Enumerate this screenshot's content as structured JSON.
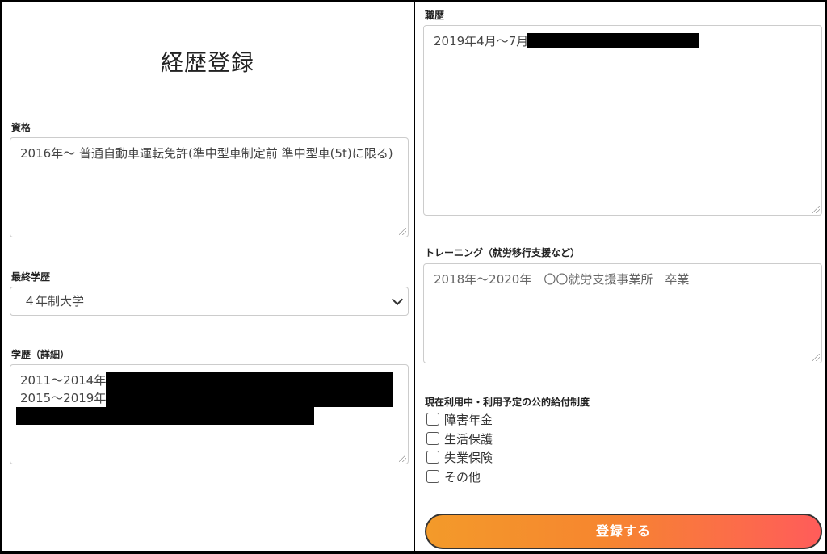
{
  "page_title": "経歴登録",
  "qualification": {
    "label": "資格",
    "value": "2016年～ 普通自動車運転免許(準中型車制定前 準中型車(5t)に限る)"
  },
  "final_education": {
    "label": "最終学歴",
    "selected": "４年制大学"
  },
  "education_detail": {
    "label": "学歴（詳細）",
    "lines": [
      "2011～2014年",
      "2015～2019年"
    ]
  },
  "work_history": {
    "label": "職歴",
    "value": "2019年4月～7月"
  },
  "training": {
    "label": "トレーニング（就労移行支援など）",
    "placeholder": "2018年～2020年　〇〇就労支援事業所　卒業"
  },
  "benefits": {
    "label": "現在利用中・利用予定の公的給付制度",
    "options": [
      "障害年金",
      "生活保護",
      "失業保険",
      "その他"
    ]
  },
  "submit_label": "登録する"
}
